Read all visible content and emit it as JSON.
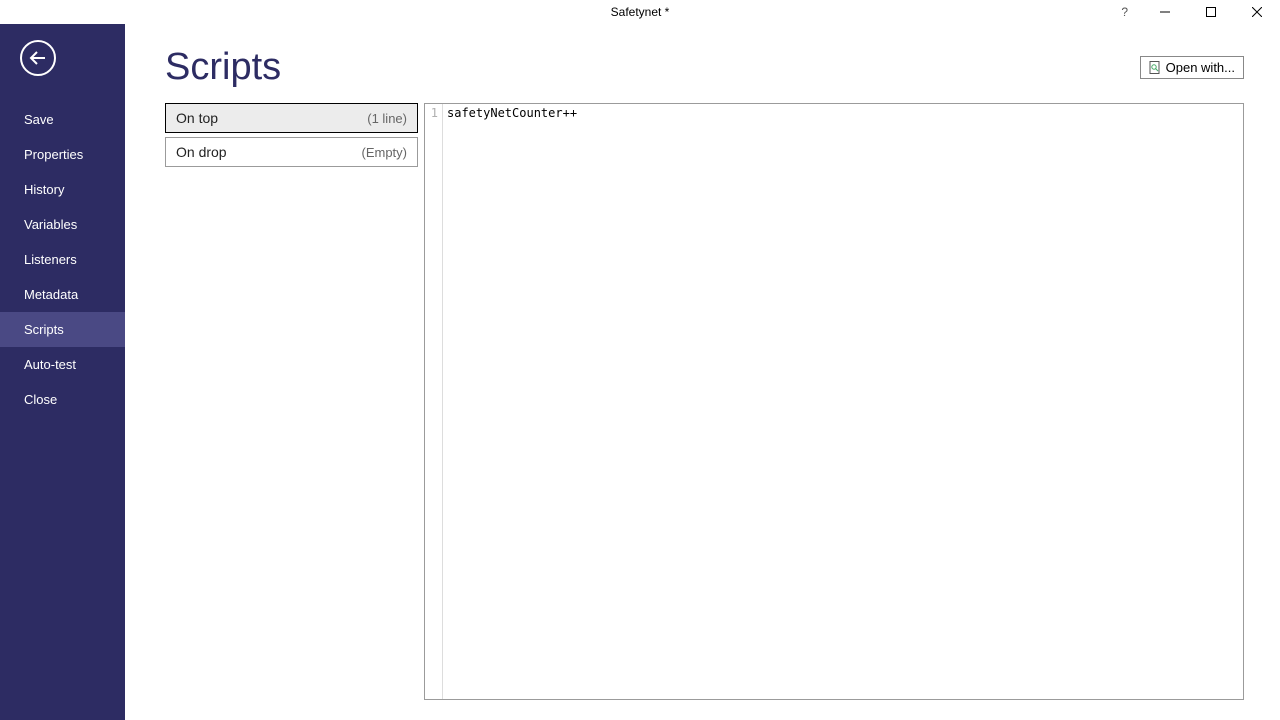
{
  "window": {
    "title": "Safetynet *"
  },
  "sidebar": {
    "items": [
      {
        "label": "Save"
      },
      {
        "label": "Properties"
      },
      {
        "label": "History"
      },
      {
        "label": "Variables"
      },
      {
        "label": "Listeners"
      },
      {
        "label": "Metadata"
      },
      {
        "label": "Scripts",
        "active": true
      },
      {
        "label": "Auto-test"
      },
      {
        "label": "Close"
      }
    ]
  },
  "page": {
    "title": "Scripts",
    "open_with_label": "Open with..."
  },
  "scripts": [
    {
      "name": "On top",
      "info": "(1 line)",
      "selected": true
    },
    {
      "name": "On drop",
      "info": "(Empty)",
      "selected": false
    }
  ],
  "editor": {
    "line_number": "1",
    "code": "safetyNetCounter++"
  },
  "titlebar_help": "?"
}
